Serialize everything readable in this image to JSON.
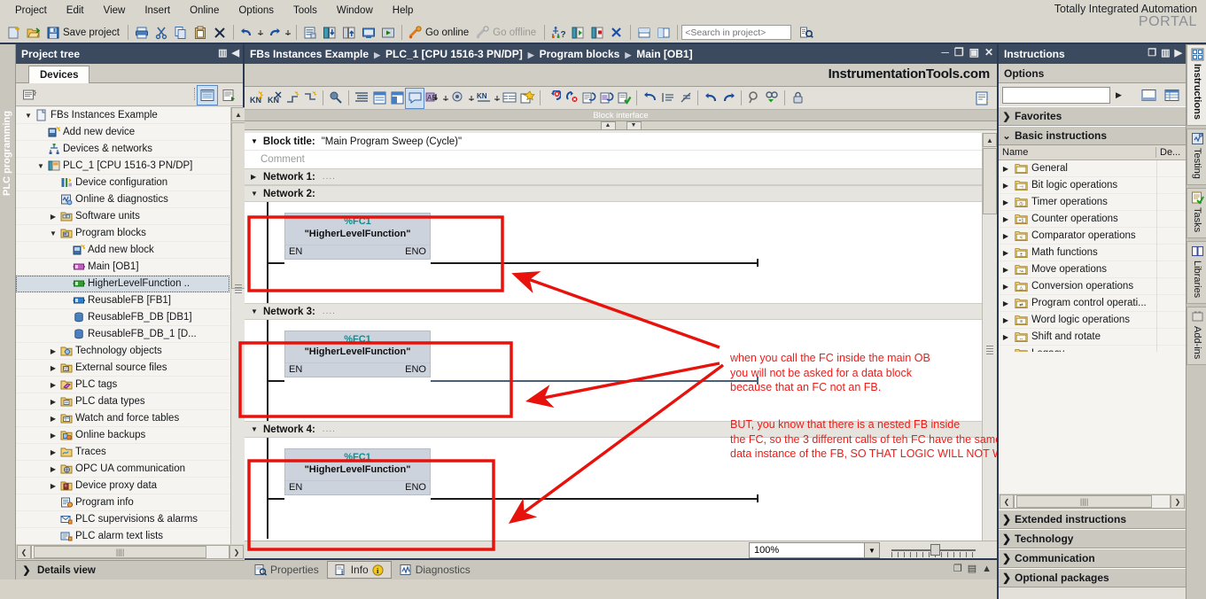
{
  "app": {
    "brand_line1": "Totally Integrated Automation",
    "brand_line2": "PORTAL"
  },
  "menubar": {
    "items": [
      {
        "label": "Project",
        "name": "menu-project"
      },
      {
        "label": "Edit",
        "name": "menu-edit"
      },
      {
        "label": "View",
        "name": "menu-view"
      },
      {
        "label": "Insert",
        "name": "menu-insert"
      },
      {
        "label": "Online",
        "name": "menu-online"
      },
      {
        "label": "Options",
        "name": "menu-options"
      },
      {
        "label": "Tools",
        "name": "menu-tools"
      },
      {
        "label": "Window",
        "name": "menu-window"
      },
      {
        "label": "Help",
        "name": "menu-help"
      }
    ]
  },
  "toolbar": {
    "save_project_label": "Save project",
    "go_online_label": "Go online",
    "go_offline_label": "Go offline",
    "search_placeholder": "<Search in project>",
    "icons": [
      "new-project-icon",
      "open-project-icon",
      "save-icon",
      "print-icon",
      "cut-icon",
      "copy-icon",
      "paste-icon",
      "delete-icon",
      "undo-icon",
      "undo-dropdown-icon",
      "redo-icon",
      "redo-dropdown-icon",
      "compile-icon",
      "download-to-device-icon",
      "upload-from-device-icon",
      "start-simulation-icon",
      "go-online-icon",
      "go-offline-icon",
      "accessible-devices-icon",
      "start-cpu-icon",
      "stop-cpu-icon",
      "cross-reference-icon",
      "split-horizontal-icon",
      "split-vertical-icon",
      "search-next-icon"
    ]
  },
  "left_strip": {
    "label": "PLC programming"
  },
  "project_tree": {
    "title": "Project tree",
    "title_icons": [
      "columns-icon",
      "collapse-left-icon"
    ],
    "tab": "Devices",
    "toolbar_icons": [
      "tree-settings-icon",
      "list-view-icon",
      "detail-view-icon"
    ],
    "details_view": "Details view",
    "items": [
      {
        "label": "FBs Instances Example",
        "indent": 0,
        "twisty": "down",
        "icon": "project-icon",
        "selected": false
      },
      {
        "label": "Add new device",
        "indent": 1,
        "twisty": "",
        "icon": "add-device-icon",
        "selected": false
      },
      {
        "label": "Devices & networks",
        "indent": 1,
        "twisty": "",
        "icon": "devices-networks-icon",
        "selected": false
      },
      {
        "label": "PLC_1 [CPU 1516-3 PN/DP]",
        "indent": 1,
        "twisty": "down",
        "icon": "plc-icon",
        "selected": false
      },
      {
        "label": "Device configuration",
        "indent": 2,
        "twisty": "",
        "icon": "device-config-icon",
        "selected": false
      },
      {
        "label": "Online & diagnostics",
        "indent": 2,
        "twisty": "",
        "icon": "online-diagnostics-icon",
        "selected": false
      },
      {
        "label": "Software units",
        "indent": 2,
        "twisty": "right",
        "icon": "folder-icon",
        "selected": false
      },
      {
        "label": "Program blocks",
        "indent": 2,
        "twisty": "down",
        "icon": "folder-blocks-icon",
        "selected": false
      },
      {
        "label": "Add new block",
        "indent": 3,
        "twisty": "",
        "icon": "add-block-icon",
        "selected": false
      },
      {
        "label": "Main [OB1]",
        "indent": 3,
        "twisty": "",
        "icon": "ob-block-icon",
        "selected": false
      },
      {
        "label": "HigherLevelFunction ..",
        "indent": 3,
        "twisty": "",
        "icon": "fc-block-icon",
        "selected": true
      },
      {
        "label": "ReusableFB [FB1]",
        "indent": 3,
        "twisty": "",
        "icon": "fb-block-icon",
        "selected": false
      },
      {
        "label": "ReusableFB_DB [DB1]",
        "indent": 3,
        "twisty": "",
        "icon": "db-block-icon",
        "selected": false
      },
      {
        "label": "ReusableFB_DB_1 [D...",
        "indent": 3,
        "twisty": "",
        "icon": "db-block-icon",
        "selected": false
      },
      {
        "label": "Technology objects",
        "indent": 2,
        "twisty": "right",
        "icon": "technology-objects-icon",
        "selected": false
      },
      {
        "label": "External source files",
        "indent": 2,
        "twisty": "right",
        "icon": "external-sources-icon",
        "selected": false
      },
      {
        "label": "PLC tags",
        "indent": 2,
        "twisty": "right",
        "icon": "plc-tags-icon",
        "selected": false
      },
      {
        "label": "PLC data types",
        "indent": 2,
        "twisty": "right",
        "icon": "plc-data-types-icon",
        "selected": false
      },
      {
        "label": "Watch and force tables",
        "indent": 2,
        "twisty": "right",
        "icon": "watch-tables-icon",
        "selected": false
      },
      {
        "label": "Online backups",
        "indent": 2,
        "twisty": "right",
        "icon": "online-backups-icon",
        "selected": false
      },
      {
        "label": "Traces",
        "indent": 2,
        "twisty": "right",
        "icon": "traces-icon",
        "selected": false
      },
      {
        "label": "OPC UA communication",
        "indent": 2,
        "twisty": "right",
        "icon": "opc-ua-icon",
        "selected": false
      },
      {
        "label": "Device proxy data",
        "indent": 2,
        "twisty": "right",
        "icon": "device-proxy-icon",
        "selected": false
      },
      {
        "label": "Program info",
        "indent": 2,
        "twisty": "",
        "icon": "program-info-icon",
        "selected": false
      },
      {
        "label": "PLC supervisions & alarms",
        "indent": 2,
        "twisty": "",
        "icon": "supervisions-alarms-icon",
        "selected": false
      },
      {
        "label": "PLC alarm text lists",
        "indent": 2,
        "twisty": "",
        "icon": "alarm-text-lists-icon",
        "selected": false
      }
    ]
  },
  "editor": {
    "breadcrumb": [
      "FBs Instances Example",
      "PLC_1 [CPU 1516-3 PN/DP]",
      "Program blocks",
      "Main [OB1]"
    ],
    "window_buttons": [
      "minimize",
      "restore",
      "maximize",
      "close"
    ],
    "watermark": "InstrumentationTools.com",
    "block_interface_label": "Block interface",
    "block_title_label": "Block title:",
    "block_title_value": "\"Main Program Sweep (Cycle)\"",
    "comment_placeholder": "Comment",
    "zoom_value": "100%",
    "networks": [
      {
        "name": "Network 1:",
        "dots": "....",
        "collapsed": true,
        "has_block": false
      },
      {
        "name": "Network 2:",
        "dots": "",
        "collapsed": false,
        "has_block": true,
        "block": {
          "id": "%FC1",
          "name": "\"HigherLevelFunction\"",
          "en": "EN",
          "eno": "ENO"
        }
      },
      {
        "name": "Network 3:",
        "dots": "....",
        "collapsed": false,
        "has_block": true,
        "block": {
          "id": "%FC1",
          "name": "\"HigherLevelFunction\"",
          "en": "EN",
          "eno": "ENO"
        }
      },
      {
        "name": "Network 4:",
        "dots": "....",
        "collapsed": false,
        "has_block": true,
        "block": {
          "id": "%FC1",
          "name": "\"HigherLevelFunction\"",
          "en": "EN",
          "eno": "ENO"
        }
      }
    ],
    "status_tabs": [
      {
        "label": "Properties",
        "icon": "properties-icon",
        "active": false
      },
      {
        "label": "Info",
        "icon": "info-icon",
        "active": true,
        "badge_icon": "info-badge-icon"
      },
      {
        "label": "Diagnostics",
        "icon": "diagnostics-icon",
        "active": false
      }
    ]
  },
  "annotations": {
    "accent_color": "#ee1c18",
    "paragraph1": [
      "when you call the FC inside the main OB",
      "you will not be asked for a data block",
      "because that an FC not an FB."
    ],
    "paragraph2": [
      "BUT, you know that there is a nested FB inside",
      "the FC, so the 3 different calls of teh FC have the same",
      "data instance of the FB, SO THAT LOGIC WILL NOT WORK"
    ]
  },
  "instructions": {
    "title": "Instructions",
    "title_icons": [
      "float-icon",
      "columns-icon",
      "collapse-right-icon"
    ],
    "options_label": "Options",
    "search_value": "",
    "option_icons": [
      "dropdown-arrow-icon",
      "single-view-icon",
      "table-view-icon"
    ],
    "favorites_label": "Favorites",
    "basic_label": "Basic instructions",
    "columns": [
      "Name",
      "De..."
    ],
    "items": [
      {
        "label": "General",
        "icon": "folder-general-icon"
      },
      {
        "label": "Bit logic operations",
        "icon": "folder-bit-logic-icon"
      },
      {
        "label": "Timer operations",
        "icon": "folder-timer-icon"
      },
      {
        "label": "Counter operations",
        "icon": "folder-counter-icon"
      },
      {
        "label": "Comparator operations",
        "icon": "folder-comparator-icon"
      },
      {
        "label": "Math functions",
        "icon": "folder-math-icon"
      },
      {
        "label": "Move operations",
        "icon": "folder-move-icon"
      },
      {
        "label": "Conversion operations",
        "icon": "folder-conversion-icon"
      },
      {
        "label": "Program control operati...",
        "icon": "folder-program-control-icon"
      },
      {
        "label": "Word logic operations",
        "icon": "folder-word-logic-icon"
      },
      {
        "label": "Shift and rotate",
        "icon": "folder-shift-rotate-icon"
      },
      {
        "label": "Legacy",
        "icon": "folder-legacy-icon"
      }
    ],
    "footer_sections": [
      "Extended instructions",
      "Technology",
      "Communication",
      "Optional packages"
    ]
  },
  "right_tabs": [
    {
      "label": "Instructions",
      "icon": "instructions-icon",
      "active": true
    },
    {
      "label": "Testing",
      "icon": "testing-icon",
      "active": false
    },
    {
      "label": "Tasks",
      "icon": "tasks-icon",
      "active": false
    },
    {
      "label": "Libraries",
      "icon": "libraries-icon",
      "active": false
    },
    {
      "label": "Add-ins",
      "icon": "addins-icon",
      "active": false
    }
  ]
}
